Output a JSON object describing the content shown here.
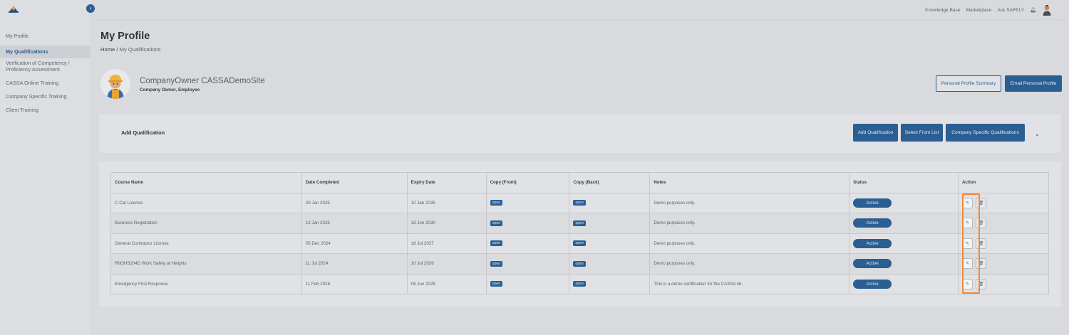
{
  "sidebar": {
    "items": [
      {
        "label": "My Profile"
      },
      {
        "label": "My Qualifications"
      },
      {
        "label": "Verification of Competency /"
      },
      {
        "label": "Proficiency Assessment"
      },
      {
        "label": "CASSA Online Training"
      },
      {
        "label": "Company Specific Training"
      },
      {
        "label": "Client Training"
      }
    ]
  },
  "topnav": {
    "knowledge_base": "Knowledge Base",
    "marketplace": "Marketplace",
    "ask": "Ask SAFELY"
  },
  "page": {
    "title": "My Profile",
    "breadcrumb_home": "Home",
    "breadcrumb_sep": "/",
    "breadcrumb_current": "My Qualifications"
  },
  "profile": {
    "name": "CompanyOwner CASSADemoSite",
    "role": "Company Owner, Employee",
    "summary_button": "Personal Profile Summary",
    "email_button": "Email Personal Profile"
  },
  "add_card": {
    "title": "Add Qualification",
    "add_button": "Add Qualification",
    "select_button": "Select From List",
    "company_button": "Company Specific Qualifications"
  },
  "table": {
    "headers": [
      "Course Name",
      "Date Completed",
      "Expiry Date",
      "Copy (Front)",
      "Copy (Back)",
      "Notes",
      "Status",
      "Action"
    ],
    "open_label": "open",
    "rows": [
      {
        "course": "C Car License",
        "completed": "20 Jan 2025",
        "expiry": "10 Jan 2035",
        "front": "open",
        "back": "open",
        "notes": "Demo purposes only.",
        "status": "Active"
      },
      {
        "course": "Business Registration",
        "completed": "12 Jan 2025",
        "expiry": "18 Jun 2030",
        "front": "open",
        "back": "open",
        "notes": "Demo purposes only.",
        "status": "Active"
      },
      {
        "course": "General Contractor License",
        "completed": "05 Dec 2024",
        "expiry": "18 Jul 2027",
        "front": "open",
        "back": "open",
        "notes": "Demo purposes only.",
        "status": "Active"
      },
      {
        "course": "RIIOHS204D Work Safely at Heights",
        "completed": "11 Jul 2024",
        "expiry": "10 Jul 2026",
        "front": "open",
        "back": "open",
        "notes": "Demo purposes only.",
        "status": "Active"
      },
      {
        "course": "Emergency First Response",
        "completed": "11 Feb 2026",
        "expiry": "06 Jun 2028",
        "front": "open",
        "back": "open",
        "notes": "This is a demo certification for the CASSA kb.",
        "status": "Active"
      }
    ]
  },
  "colors": {
    "accent": "#2b5e92",
    "highlight": "#f08a3c"
  }
}
